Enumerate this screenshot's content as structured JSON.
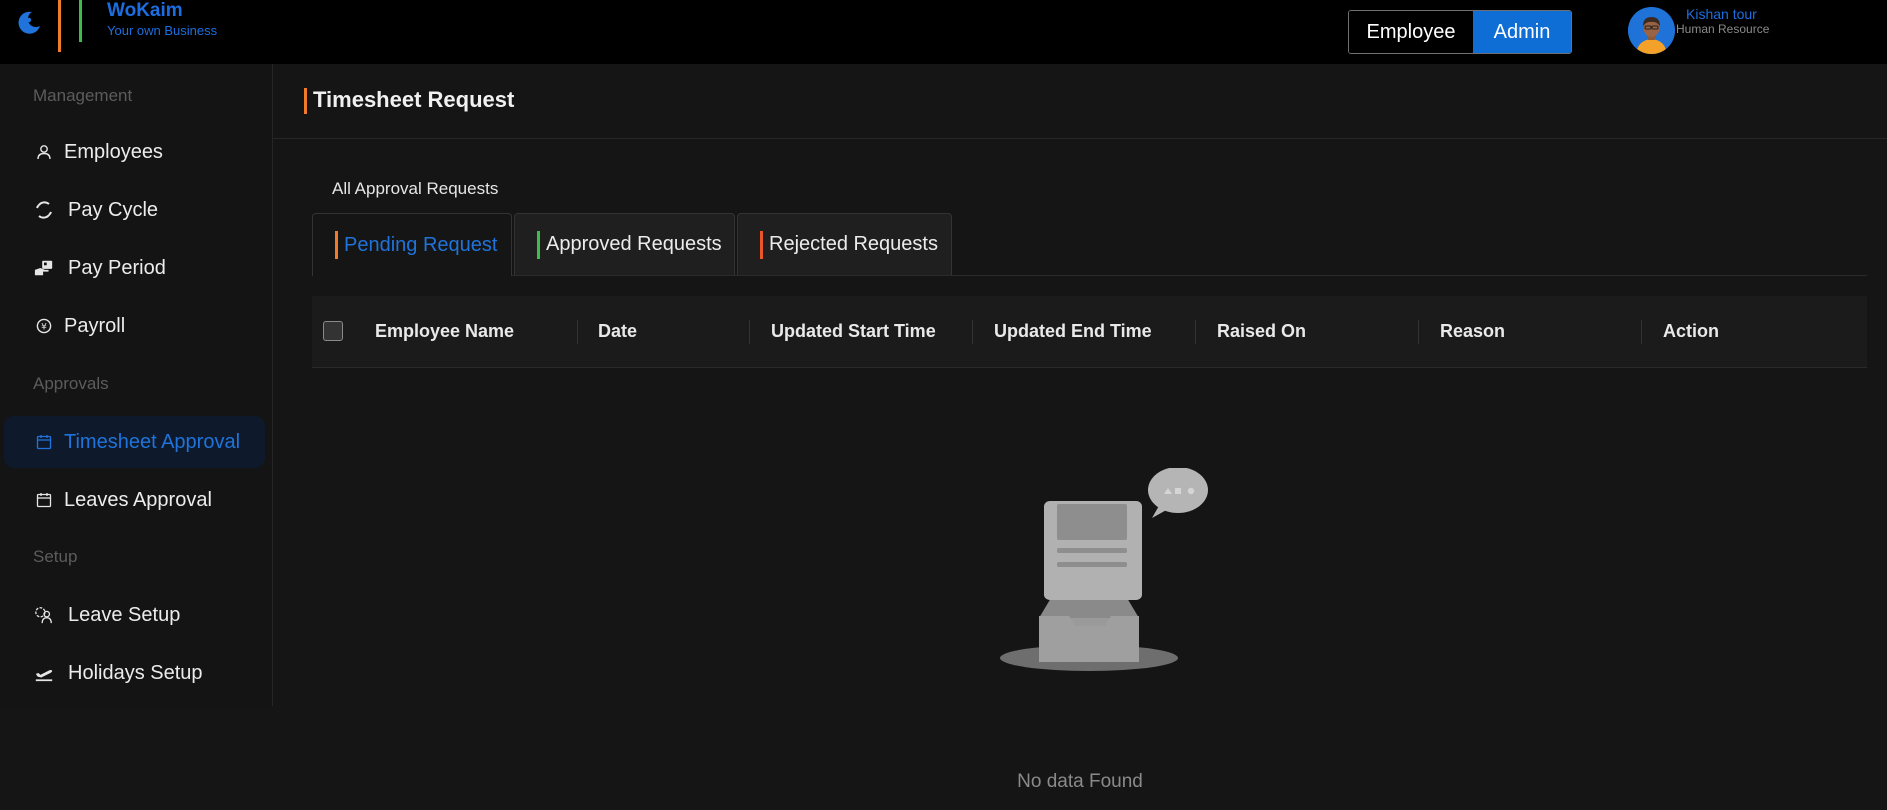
{
  "brand": {
    "name": "WoKaim",
    "tagline": "Your own Business"
  },
  "role_switch": {
    "employee_label": "Employee",
    "admin_label": "Admin",
    "selected": "Admin"
  },
  "user": {
    "name": "Kishan tour",
    "role": "Human Resource"
  },
  "sidebar": {
    "sections": {
      "management": "Management",
      "approvals": "Approvals",
      "setup": "Setup"
    },
    "items": [
      {
        "label": "Employees",
        "icon": "user-icon"
      },
      {
        "label": "Pay Cycle",
        "icon": "cycle-icon"
      },
      {
        "label": "Pay Period",
        "icon": "hand-money-icon"
      },
      {
        "label": "Payroll",
        "icon": "yen-coin-icon"
      },
      {
        "label": "Timesheet Approval",
        "icon": "calendar-icon",
        "active": true
      },
      {
        "label": "Leaves Approval",
        "icon": "calendar-icon"
      },
      {
        "label": "Leave Setup",
        "icon": "user-settings-icon"
      },
      {
        "label": "Holidays Setup",
        "icon": "plane-takeoff-icon"
      }
    ]
  },
  "page": {
    "title": "Timesheet Request",
    "subheading": "All Approval Requests",
    "tabs": [
      {
        "label": "Pending Request",
        "accent": "#f07b2b",
        "active": true
      },
      {
        "label": "Approved Requests",
        "accent": "#3bbf4a"
      },
      {
        "label": "Rejected Requests",
        "accent": "#e8562a"
      }
    ],
    "table": {
      "columns": [
        "Employee Name",
        "Date",
        "Updated Start Time",
        "Updated End Time",
        "Raised On",
        "Reason",
        "Action"
      ]
    },
    "empty_text": "No data Found"
  },
  "colors": {
    "accent_blue": "#1f73db",
    "admin_button": "#0f6ed6",
    "logo_orange": "#f07b2b",
    "logo_green": "#3bbf4a"
  }
}
